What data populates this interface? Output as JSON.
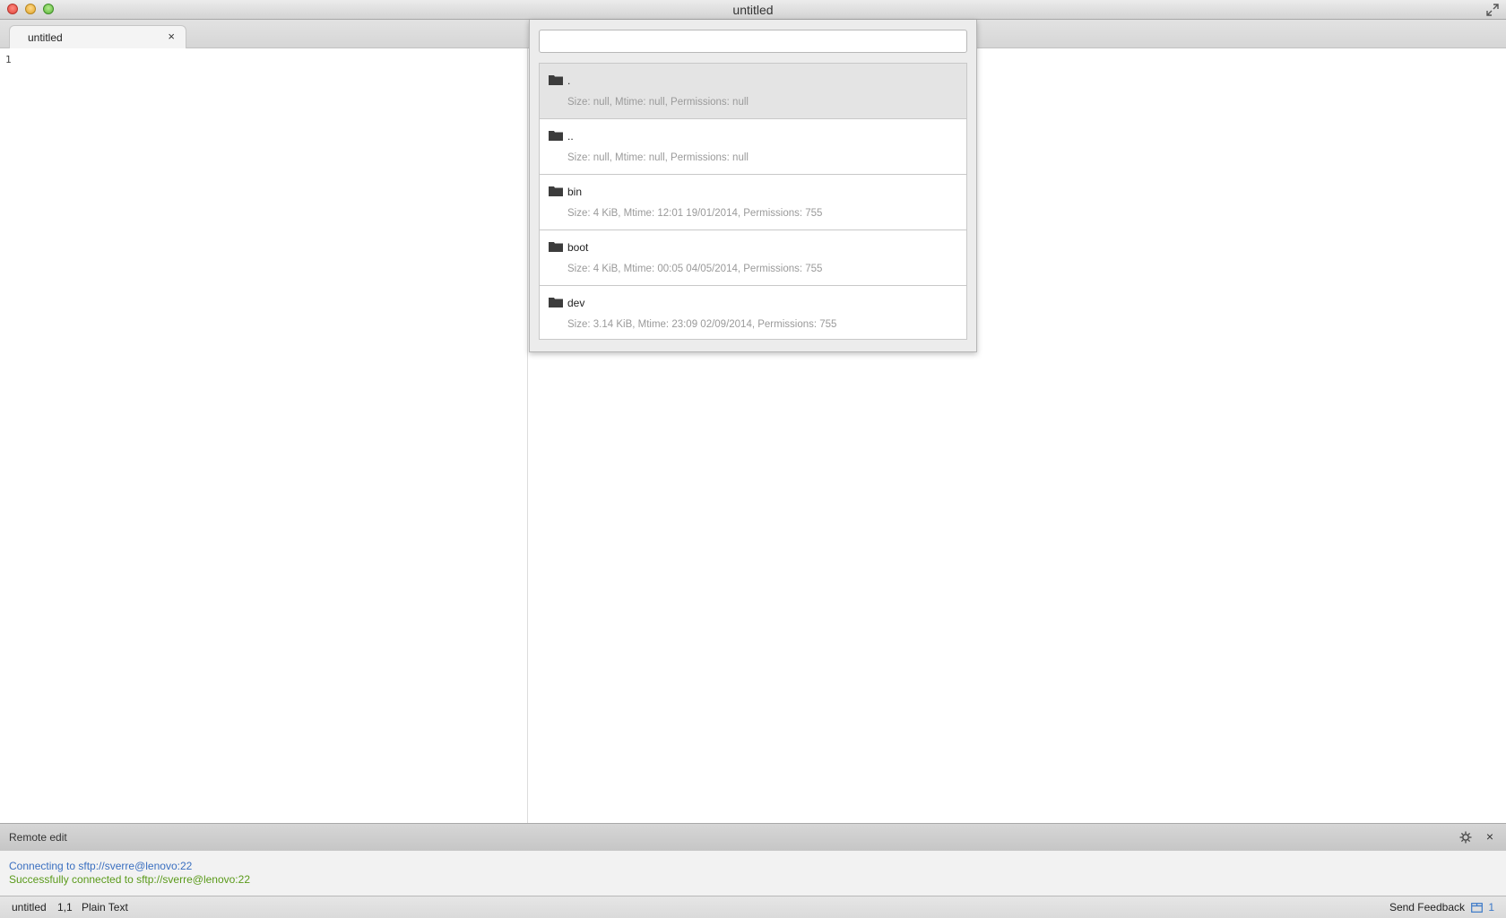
{
  "window": {
    "title": "untitled"
  },
  "tabs": [
    {
      "label": "untitled",
      "close_icon": "×"
    }
  ],
  "editor": {
    "line_numbers": [
      "1"
    ]
  },
  "palette": {
    "query": "",
    "items": [
      {
        "icon": "folder-icon",
        "name": ".",
        "meta": "Size: null, Mtime: null, Permissions: null",
        "selected": true
      },
      {
        "icon": "folder-icon",
        "name": "..",
        "meta": "Size: null, Mtime: null, Permissions: null"
      },
      {
        "icon": "folder-icon",
        "name": "bin",
        "meta": "Size: 4 KiB, Mtime: 12:01 19/01/2014, Permissions: 755"
      },
      {
        "icon": "folder-icon",
        "name": "boot",
        "meta": "Size: 4 KiB, Mtime: 00:05 04/05/2014, Permissions: 755"
      },
      {
        "icon": "folder-icon",
        "name": "dev",
        "meta": "Size: 3.14 KiB, Mtime: 23:09 02/09/2014, Permissions: 755"
      }
    ]
  },
  "panel": {
    "title": "Remote edit",
    "close_icon": "×",
    "lines": [
      {
        "text": "Connecting to sftp://sverre@lenovo:22",
        "color": "#3a6fc0"
      },
      {
        "text": "Successfully connected to sftp://sverre@lenovo:22",
        "color": "#5a9a1a"
      }
    ]
  },
  "statusbar": {
    "file": "untitled",
    "position": "1,1",
    "syntax": "Plain Text",
    "feedback": "Send Feedback",
    "count": "1"
  }
}
